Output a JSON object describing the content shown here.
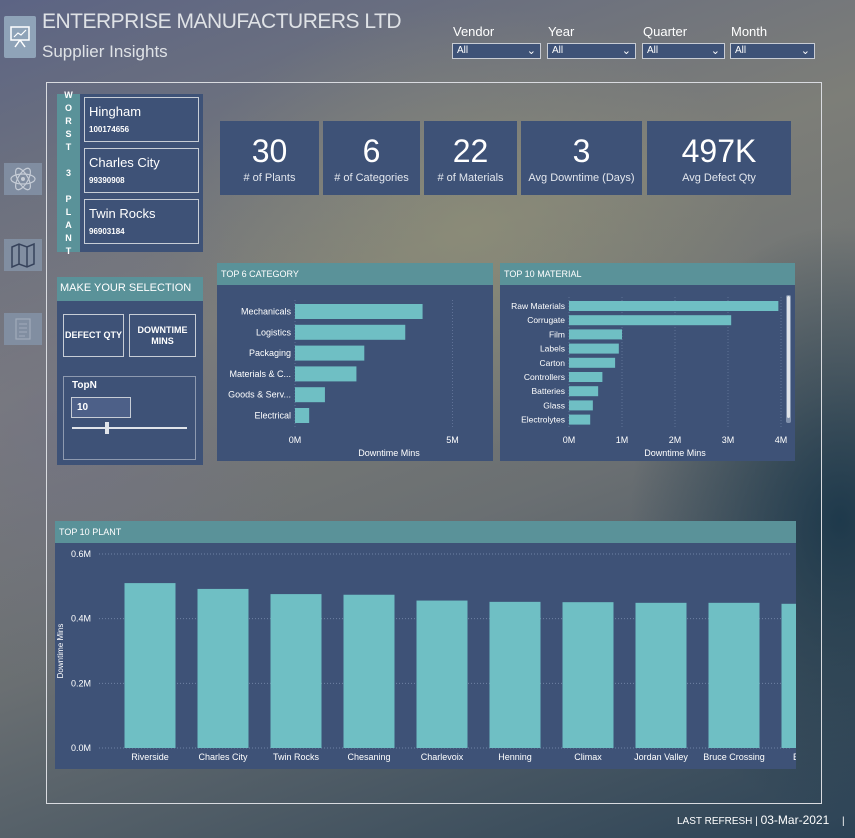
{
  "header": {
    "title": "ENTERPRISE MANUFACTURERS LTD",
    "subtitle": "Supplier Insights"
  },
  "filters": [
    {
      "label": "Vendor",
      "value": "All"
    },
    {
      "label": "Year",
      "value": "All"
    },
    {
      "label": "Quarter",
      "value": "All"
    },
    {
      "label": "Month",
      "value": "All"
    }
  ],
  "side_icons": [
    "atom-icon",
    "map-icon",
    "document-icon"
  ],
  "worst": {
    "label_chars": [
      "W",
      "O",
      "R",
      "S",
      "T",
      "",
      "3",
      "",
      "P",
      "L",
      "A",
      "N",
      "T"
    ],
    "plants": [
      {
        "name": "Hingham",
        "id": "100174656"
      },
      {
        "name": "Charles City",
        "id": "99390908"
      },
      {
        "name": "Twin Rocks",
        "id": "96903184"
      }
    ]
  },
  "kpis": [
    {
      "value": "30",
      "label": "# of Plants"
    },
    {
      "value": "6",
      "label": "# of Categories"
    },
    {
      "value": "22",
      "label": "# of Materials"
    },
    {
      "value": "3",
      "label": "Avg Downtime (Days)"
    },
    {
      "value": "497K",
      "label": "Avg Defect Qty"
    }
  ],
  "selection": {
    "title": "MAKE YOUR SELECTION",
    "defect_btn": "DEFECT QTY",
    "downtime_btn_line1": "DOWNTIME",
    "downtime_btn_line2": "MINS",
    "topn_label": "TopN",
    "topn_value": "10",
    "topn_level": 0.3
  },
  "footer": {
    "label": "LAST REFRESH",
    "date": "03-Mar-2021"
  },
  "colors": {
    "bar": "#6fbfc4",
    "panel": "#3e5277",
    "header": "#5a9299"
  },
  "chart_data": [
    {
      "id": "category",
      "type": "bar",
      "orientation": "horizontal",
      "title": "TOP 6 CATEGORY",
      "xlabel": "Downtime Mins",
      "categories": [
        "Mechanicals",
        "Logistics",
        "Packaging",
        "Materials & C...",
        "Goods & Serv...",
        "Electrical"
      ],
      "values": [
        4050000,
        3500000,
        2200000,
        1950000,
        950000,
        450000
      ],
      "xlim": [
        0,
        6000000
      ],
      "ticks": [
        {
          "v": 0,
          "label": "0M"
        },
        {
          "v": 5000000,
          "label": "5M"
        }
      ]
    },
    {
      "id": "material",
      "type": "bar",
      "orientation": "horizontal",
      "title": "TOP 10 MATERIAL",
      "xlabel": "Downtime Mins",
      "categories": [
        "Raw Materials",
        "Corrugate",
        "Film",
        "Labels",
        "Carton",
        "Controllers",
        "Batteries",
        "Glass",
        "Electrolytes"
      ],
      "values": [
        3950000,
        3060000,
        1000000,
        940000,
        870000,
        630000,
        550000,
        450000,
        400000
      ],
      "xlim": [
        0,
        4000000
      ],
      "ticks": [
        {
          "v": 0,
          "label": "0M"
        },
        {
          "v": 1000000,
          "label": "1M"
        },
        {
          "v": 2000000,
          "label": "2M"
        },
        {
          "v": 3000000,
          "label": "3M"
        },
        {
          "v": 4000000,
          "label": "4M"
        }
      ]
    },
    {
      "id": "plant",
      "type": "bar",
      "orientation": "vertical",
      "title": "TOP 10 PLANT",
      "ylabel": "Downtime Mins",
      "categories": [
        "Riverside",
        "Charles City",
        "Twin Rocks",
        "Chesaning",
        "Charlevoix",
        "Henning",
        "Climax",
        "Jordan Valley",
        "Bruce Crossing",
        "Barling"
      ],
      "values": [
        510000,
        492000,
        476000,
        474000,
        456000,
        452000,
        451000,
        449000,
        449000,
        446000
      ],
      "ylim": [
        0,
        600000
      ],
      "ticks": [
        {
          "v": 0,
          "label": "0.0M"
        },
        {
          "v": 200000,
          "label": "0.2M"
        },
        {
          "v": 400000,
          "label": "0.4M"
        },
        {
          "v": 600000,
          "label": "0.6M"
        }
      ]
    }
  ]
}
